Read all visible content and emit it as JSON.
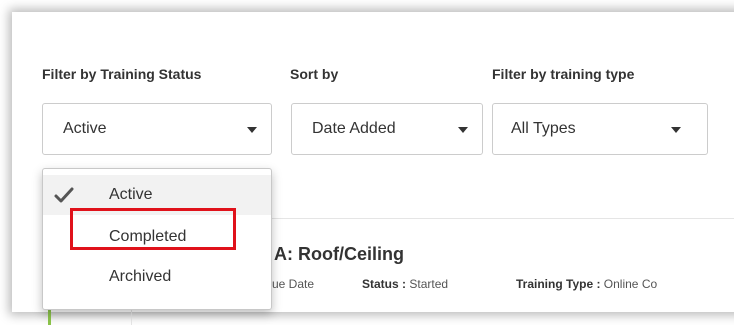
{
  "filters": {
    "status_label": "Filter by Training Status",
    "sort_label": "Sort by",
    "type_label": "Filter by training type",
    "status_value": "Active",
    "sort_value": "Date Added",
    "type_value": "All Types"
  },
  "dropdown": {
    "options": [
      {
        "label": "Active",
        "selected": true
      },
      {
        "label": "Completed",
        "selected": false
      },
      {
        "label": "Archived",
        "selected": false
      }
    ]
  },
  "course": {
    "title_partial": "A: Roof/Ceiling",
    "due_date_partial": "ue Date",
    "status_label": "Status :",
    "status_value": "Started",
    "type_label": "Training Type :",
    "type_value_partial": "Online Co"
  },
  "colors": {
    "highlight_border": "#e0121b",
    "accent_green": "#8bc34a",
    "text": "#333333"
  },
  "icons": {
    "check": "check-icon",
    "caret": "caret-down-icon"
  }
}
